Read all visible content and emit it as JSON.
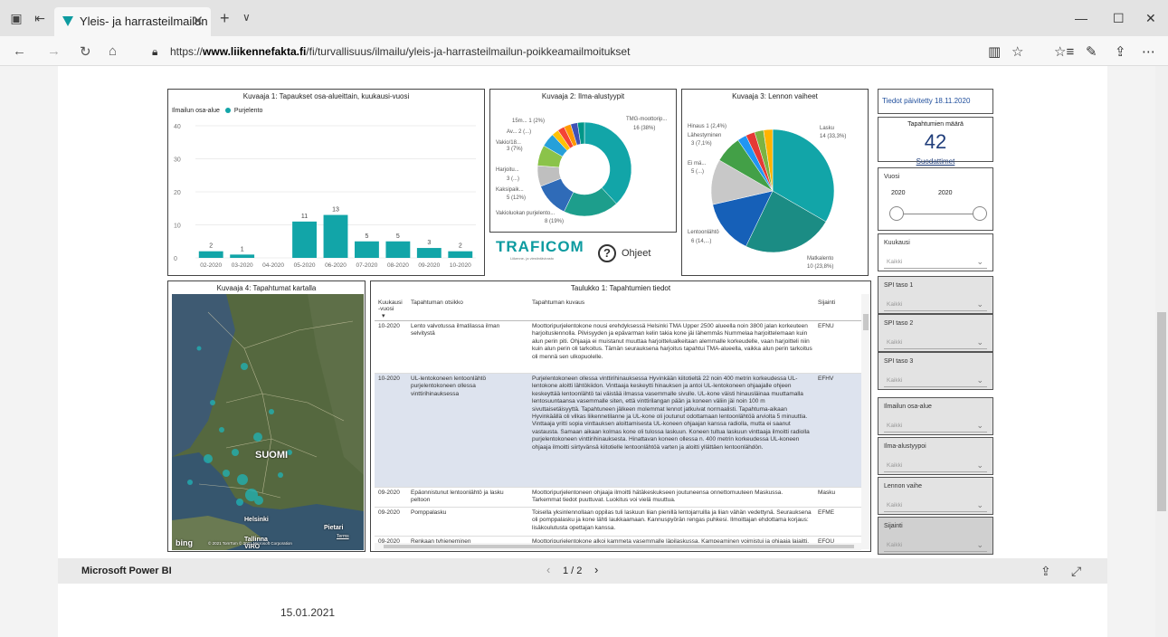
{
  "browser": {
    "tab_title": "Yleis- ja harrasteilmailun",
    "url_prefix": "https://",
    "url_domain": "www.liikennefakta.fi",
    "url_path": "/fi/turvallisuus/ilmailu/yleis-ja-harrasteilmailun-poikkeamailmoitukset"
  },
  "chart1": {
    "title": "Kuvaaja 1: Tapaukset osa-alueittain, kuukausi-vuosi",
    "legend_title": "Ilmailun osa-alue",
    "legend_item": "Purjelento",
    "y_ticks": [
      "40",
      "30",
      "20",
      "10",
      "0"
    ]
  },
  "chart2": {
    "title": "Kuvaaja 2: Ilma-alustyypit",
    "labels": [
      "15m... 1 (2%)",
      "Av... 2 (...)",
      "Vakio/18...",
      "3 (7%)",
      "Harjoitu...",
      "3 (...)",
      "Kaksipaik...",
      "5 (12%)",
      "Vakioluokan purjelento...",
      "8 (19%)",
      "TMG-moottorip...",
      "16 (38%)"
    ]
  },
  "chart3": {
    "title": "Kuvaaja 3: Lennon vaiheet",
    "labels": [
      "Hinaus 1 (2,4%)",
      "Lähestyminen",
      "3 (7,1%)",
      "Ei mä...",
      "5 (...)",
      "Lentoonlähtö",
      "6 (14,...)",
      "Lasku",
      "14 (33,3%)",
      "Matkalento",
      "10 (23,8%)"
    ]
  },
  "logo": {
    "name": "TRAFICOM",
    "sub": "Liikenne- ja viestintävirasto"
  },
  "help_label": "Ohjeet",
  "map": {
    "title": "Kuvaaja 4: Tapahtumat kartalla",
    "country": "SUOMI",
    "city1": "Helsinki",
    "city2": "Tallinna",
    "city3": "Pietari",
    "country2": "VIRO",
    "bing": "bing",
    "copyright": "© 2021 TomTom © 2021 Microsoft Corporation",
    "terms": "Terms"
  },
  "table": {
    "title": "Taulukko 1: Tapahtumien tiedot",
    "headers": [
      "Kuukausi -vuosi",
      "Tapahtuman otsikko",
      "Tapahtuman kuvaus",
      "Sijainti"
    ],
    "rows": [
      {
        "date": "10-2020",
        "title": "Lento valvotussa ilmatilassa ilman selvitystä",
        "desc": "Moottoripurjelentokone nousi erehdyksessä Helsinki TMA Upper 2500 alueella noin 3800 jalan korkeuteen harjoituslennolla. Pilvisyyden ja epävarman kelin takia kone jäi lähemmäs Nummelaa harjoittelemaan kuin alun perin piti. Ohjaaja ei muistanut muuttaa harjoittelualkeitaan alemmalle korkeudelle, vaan harjoitteli niin kuin alun perin oli tarkoitus. Tämän seurauksena harjoitus tapahtui TMA-alueella, vaikka alun perin tarkoitus oli mennä sen ulkopuolelle.",
        "loc": "EFNU"
      },
      {
        "date": "10-2020",
        "title": "UL-lentokoneen lentoonlähtö purjelentokoneen ollessa vinttirihinauksessa",
        "desc": "Purjelentokoneen ollessa vinttirihinauksessa Hyvinkään kiitotieltä 22 noin 400 metrin korkeudessa UL-lentokone aloitti lähtökiidon. Vinttaaja keskeytti hinauksen ja antoi UL-lentokoneen ohjaajalle ohjeen keskeyttää lentoonlähtö tai väistää ilmassa vasemmalle sivulle. UL-kone väisti hinausläinaa muuttamalla lentosuuntaansa vasemmalle siten, että vinttirilangan pään ja koneen väliin jäi noin 100 m sivuttaisetäisyyttä. Tapahtuneen jälkeen molemmat lennot jatkuivat normaalisti. Tapahtuma-aikaan Hyvinkäällä oli vilkas liikennetilanne ja UL-kone oli joutunut odottamaan lentoonlähtöä arviolta 5 minuuttia. Vinttaaja yritti sopia vinttauksen aloittamisesta UL-koneen ohjaajan kanssa radiolla, mutta ei saanut vastausta. Samaan aikaan kolmas kone oli tulossa laskuun. Koneen tultua laskuun vinttaaja ilmoitti radiolla purjelentokoneen vinttirihinauksesta. Hinattavan koneen ollessa n. 400 metrin korkeudessa UL-koneen ohjaaja ilmoitti siirtyvänsä kiitotielle lentoonlähtöä varten ja aloitti yllättäen lentoonlähdön.",
        "loc": "EFHV"
      },
      {
        "date": "09-2020",
        "title": "Epäonnistunut lentoonlähtö ja lasku peltoon",
        "desc": "Moottoripurjelentoneen ohjaaja ilmoitti hätäkeskukseen joutuneensa onnettomuuteen Maskussa. Tarkemmat tiedot puuttuvat. Luokitus voi vielä muuttua.",
        "loc": "Masku"
      },
      {
        "date": "09-2020",
        "title": "Pomppalasku",
        "desc": "Toisella yksinlennollaan oppilas tuli laskuun liian pienillä lentojarruilla ja liian vähän vedettynä. Seurauksena oli pomppalasku ja kone lähti laukkaamaan. Kannuspyörän rengas puhkesi. Ilmoittajan ehdottama korjaus: lisäkoulutusta opettajan kanssa.",
        "loc": "EFME"
      },
      {
        "date": "09-2020",
        "title": "Renkaan tyhjeneminen",
        "desc": "Moottoripurjelentokone alkoi kammeta vasemmalle läpilaskussa. Kampeaminen voimistui ja ohjaaja laiaitti. Lopulta rengas tyhjeni kokonaan, mutta vauhtia oli niin vähän, että ohjattavuus",
        "loc": "EFOU"
      }
    ]
  },
  "filters": {
    "updated": "Tiedot päivitetty 18.11.2020",
    "count_label": "Tapahtumien määrä",
    "count_value": "42",
    "filters_link": "Suodattimet",
    "year_label": "Vuosi",
    "year_from": "2020",
    "year_to": "2020",
    "items": [
      {
        "label": "Kuukausi",
        "value": "Kaikki"
      },
      {
        "label": "SPI taso 1",
        "value": "Kaikki"
      },
      {
        "label": "SPI taso 2",
        "value": "Kaikki"
      },
      {
        "label": "SPI taso 3",
        "value": "Kaikki"
      },
      {
        "label": "Ilmailun osa-alue",
        "value": "Kaikki"
      },
      {
        "label": "Ilma-alustyypoi",
        "value": "Kaikki"
      },
      {
        "label": "Lennon vaihe",
        "value": "Kaikki"
      },
      {
        "label": "Sijainti",
        "value": "Kaikki"
      }
    ]
  },
  "pbi": {
    "brand": "Microsoft Power BI",
    "pager": "1 / 2"
  },
  "footer_date": "15.01.2021",
  "chart_data": {
    "type": "bar",
    "title": "Kuvaaja 1: Tapaukset osa-alueittain, kuukausi-vuosi",
    "categories": [
      "02-2020",
      "03-2020",
      "04-2020",
      "05-2020",
      "06-2020",
      "07-2020",
      "08-2020",
      "09-2020",
      "10-2020"
    ],
    "series": [
      {
        "name": "Purjelento",
        "values": [
          2,
          1,
          0,
          11,
          13,
          5,
          5,
          3,
          2
        ]
      }
    ],
    "ylim": [
      0,
      40
    ],
    "color": "#12a5a8"
  },
  "donut_data": {
    "values": [
      16,
      8,
      5,
      3,
      3,
      2,
      1,
      1,
      1,
      1,
      1
    ],
    "colors": [
      "#12a5a8",
      "#1d9e8c",
      "#2f6bb8",
      "#bfbfbf",
      "#8bc34a",
      "#26a0da",
      "#ffc107",
      "#f44336",
      "#ff9800",
      "#3f51b5",
      "#009688"
    ]
  },
  "pie_data": {
    "values": [
      14,
      10,
      6,
      5,
      3,
      1,
      1,
      1,
      1
    ],
    "colors": [
      "#12a5a8",
      "#1b8c84",
      "#1660b8",
      "#c8c8c8",
      "#43a047",
      "#2196f3",
      "#e53935",
      "#7cb342",
      "#ffb300"
    ]
  }
}
